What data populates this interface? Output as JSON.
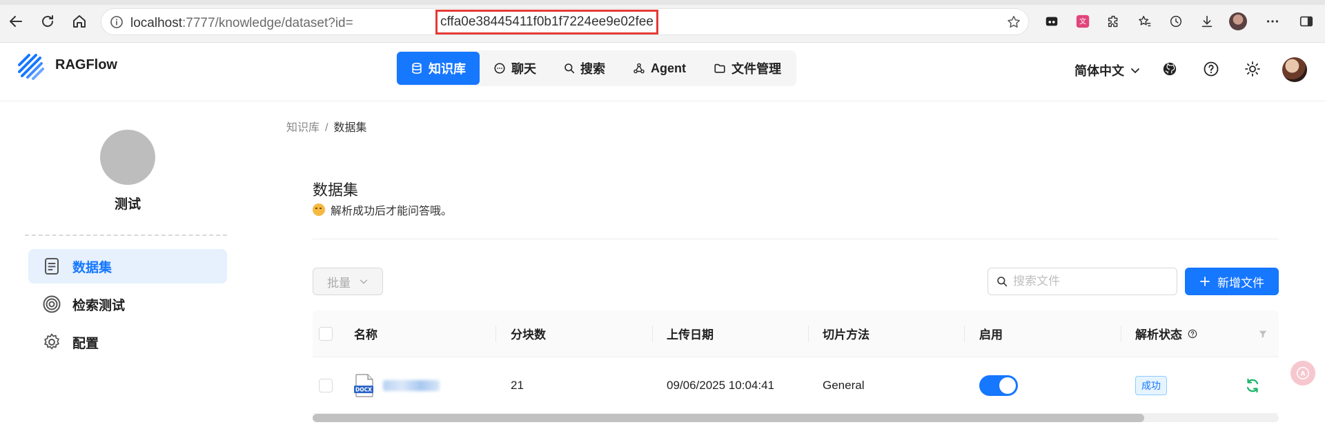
{
  "browser": {
    "url_host": "localhost",
    "url_rest": ":7777/knowledge/dataset?id=",
    "url_id": "cffa0e38445411f0b1f7224ee9e02fee"
  },
  "header": {
    "brand": "RAGFlow",
    "nav": [
      {
        "label": "知识库",
        "icon": "database-icon",
        "active": true
      },
      {
        "label": "聊天",
        "icon": "chat-icon",
        "active": false
      },
      {
        "label": "搜索",
        "icon": "search-icon",
        "active": false
      },
      {
        "label": "Agent",
        "icon": "agent-icon",
        "active": false
      },
      {
        "label": "文件管理",
        "icon": "folder-icon",
        "active": false
      }
    ],
    "language": "简体中文"
  },
  "sidebar": {
    "kb_name": "测试",
    "items": [
      {
        "label": "数据集",
        "icon": "document-icon",
        "active": true
      },
      {
        "label": "检索测试",
        "icon": "target-icon",
        "active": false
      },
      {
        "label": "配置",
        "icon": "gear-icon",
        "active": false
      }
    ]
  },
  "breadcrumb": {
    "parent": "知识库",
    "separator": "/",
    "current": "数据集"
  },
  "main": {
    "title": "数据集",
    "description": "解析成功后才能问答哦。",
    "batch_label": "批量",
    "search_placeholder": "搜索文件",
    "add_label": "新增文件"
  },
  "table": {
    "columns": [
      "名称",
      "分块数",
      "上传日期",
      "切片方法",
      "启用",
      "解析状态"
    ],
    "rows": [
      {
        "file_type": "DOCX",
        "chunks": "21",
        "upload_date": "09/06/2025 10:04:41",
        "method": "General",
        "enabled": true,
        "status": "成功"
      }
    ]
  },
  "colors": {
    "accent": "#1677ff",
    "highlight_box": "#e53935"
  }
}
